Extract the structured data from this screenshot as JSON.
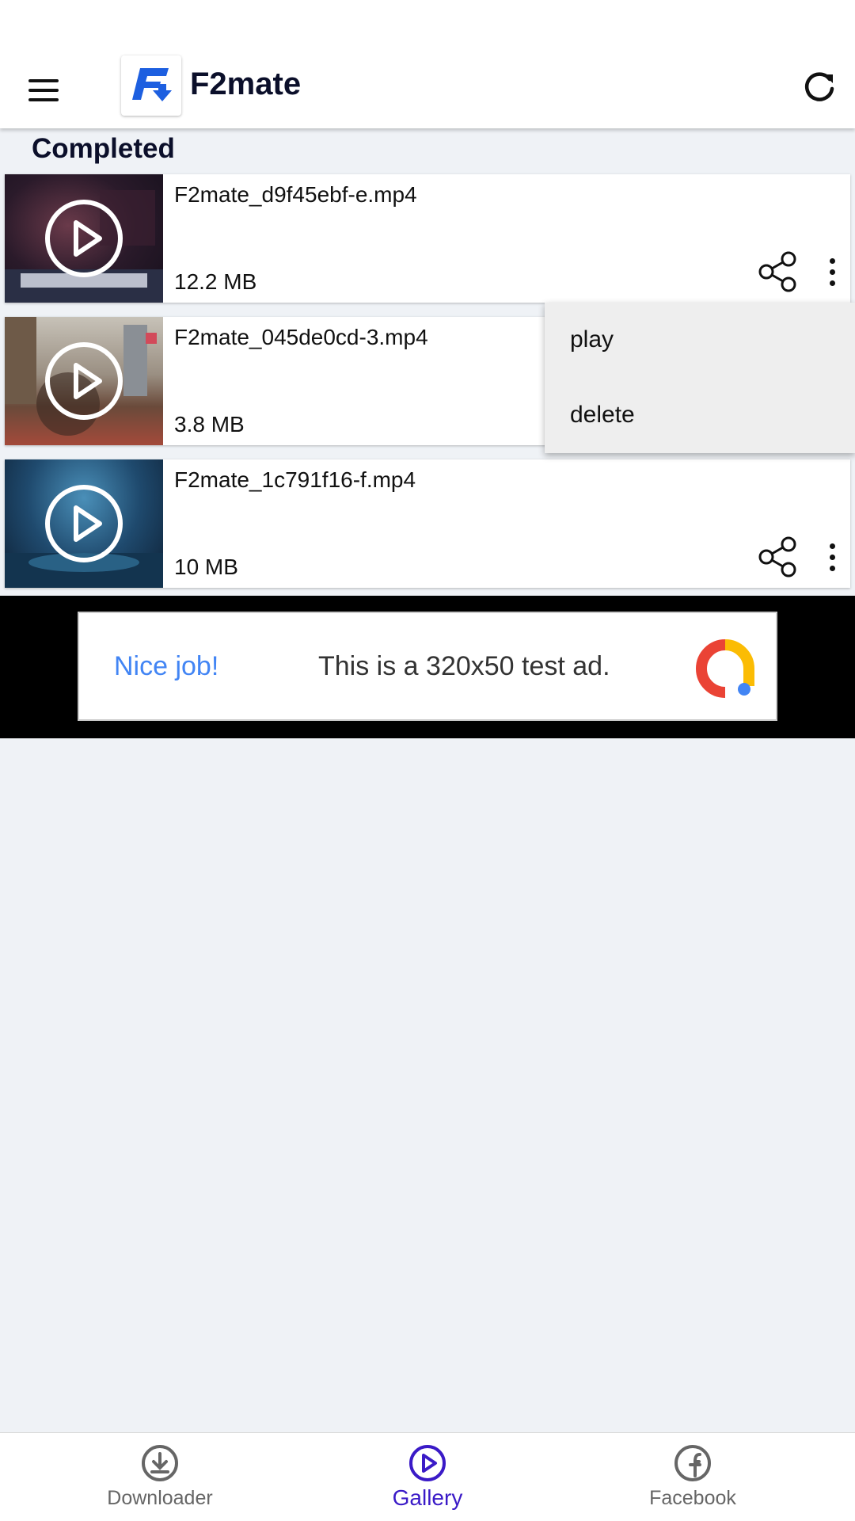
{
  "app": {
    "title": "F2mate",
    "menu_icon": "hamburger-menu-icon",
    "refresh_icon": "refresh-icon",
    "brand_color": "#1d5fe0"
  },
  "section": {
    "title": "Completed"
  },
  "videos": [
    {
      "filename": "F2mate_d9f45ebf-e.mp4",
      "size": "12.2 MB"
    },
    {
      "filename": "F2mate_045de0cd-3.mp4",
      "size": "3.8 MB"
    },
    {
      "filename": "F2mate_1c791f16-f.mp4",
      "size": "10 MB"
    }
  ],
  "popup_menu": {
    "items": [
      {
        "label": "play"
      },
      {
        "label": "delete"
      }
    ]
  },
  "ad": {
    "headline": "Nice job!",
    "text": "This is a 320x50 test ad."
  },
  "bottom_nav": {
    "items": [
      {
        "label": "Downloader",
        "icon": "download-icon",
        "active": false
      },
      {
        "label": "Gallery",
        "icon": "play-circle-icon",
        "active": true
      },
      {
        "label": "Facebook",
        "icon": "facebook-icon",
        "active": false
      }
    ],
    "active_color": "#3a1ac7"
  }
}
